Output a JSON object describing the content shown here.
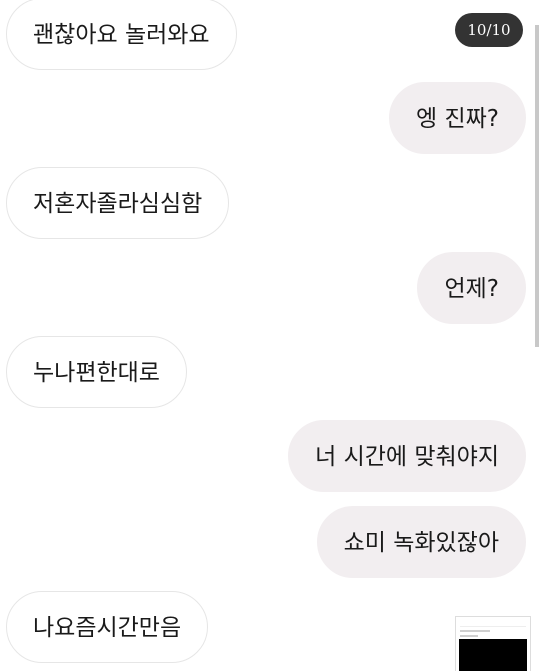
{
  "counter": "10/10",
  "messages": [
    {
      "side": "incoming",
      "text": "괜찮아요 놀러와요"
    },
    {
      "side": "outgoing",
      "text": "엥 진짜?"
    },
    {
      "side": "incoming",
      "text": "저혼자졸라심심함"
    },
    {
      "side": "outgoing",
      "text": "언제?"
    },
    {
      "side": "incoming",
      "text": "누나편한대로"
    },
    {
      "side": "outgoing",
      "text": "너 시간에 맞춰야지"
    },
    {
      "side": "outgoing",
      "text": "쇼미 녹화있잖아"
    },
    {
      "side": "incoming",
      "text": "나요즘시간만음"
    }
  ],
  "colors": {
    "outgoing_bubble": "#f2eef0",
    "incoming_bubble": "#ffffff",
    "counter_bg": "#333333"
  }
}
